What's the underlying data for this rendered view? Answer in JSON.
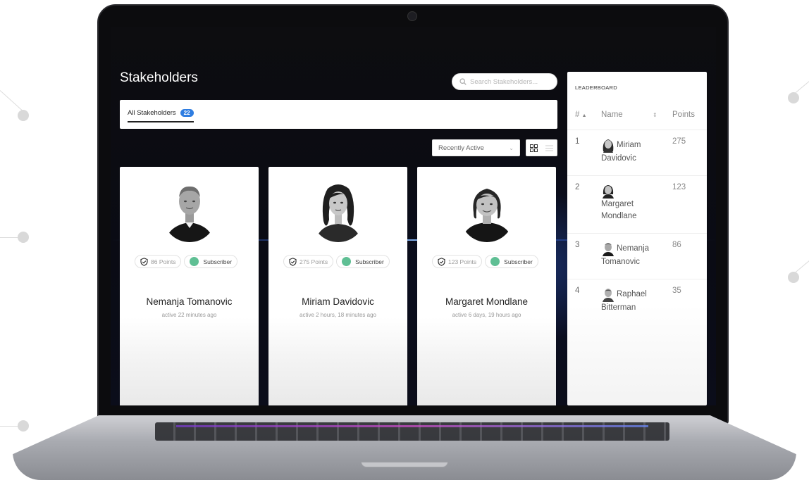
{
  "page": {
    "title": "Stakeholders",
    "search_placeholder": "Search Stakeholders..."
  },
  "tabs": [
    {
      "label": "All Stakeholders",
      "count": "22"
    }
  ],
  "toolbar": {
    "sort_value": "Recently Active"
  },
  "cards": [
    {
      "name": "Nemanja Tomanovic",
      "points_label": "86 Points",
      "role": "Subscriber",
      "active": "active 22 minutes ago"
    },
    {
      "name": "Miriam Davidovic",
      "points_label": "275 Points",
      "role": "Subscriber",
      "active": "active 2 hours, 18 minutes ago"
    },
    {
      "name": "Margaret Mondlane",
      "points_label": "123 Points",
      "role": "Subscriber",
      "active": "active 6 days, 19 hours ago"
    }
  ],
  "leaderboard": {
    "title": "LEADERBOARD",
    "headers": {
      "rank": "#",
      "name": "Name",
      "points": "Points"
    },
    "rows": [
      {
        "rank": "1",
        "first": "Miriam",
        "last": "Davidovic",
        "points": "275"
      },
      {
        "rank": "2",
        "first": "Margaret",
        "last": "Mondlane",
        "points": "123"
      },
      {
        "rank": "3",
        "first": "Nemanja",
        "last": "Tomanovic",
        "points": "86"
      },
      {
        "rank": "4",
        "first": "Raphael",
        "last": "Bitterman",
        "points": "35"
      }
    ]
  },
  "colors": {
    "badge_blue": "#2f7de1",
    "role_green": "#5fbf94",
    "screen_bg": "#0d0d10"
  },
  "icons": [
    "search-icon",
    "shield-check-icon",
    "grid-view-icon",
    "list-view-icon",
    "sort-arrow-icon",
    "chevron-down-icon"
  ]
}
